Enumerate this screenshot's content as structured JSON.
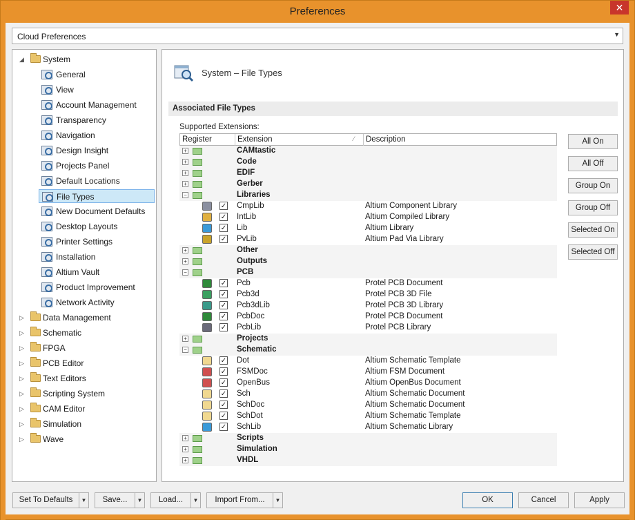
{
  "window": {
    "title": "Preferences",
    "close_glyph": "✕"
  },
  "cloud_combo": {
    "value": "Cloud Preferences"
  },
  "tree": {
    "items": [
      {
        "label": "System",
        "level": 0,
        "expanded": true,
        "icon": "folder-open-icon"
      },
      {
        "label": "General",
        "level": 1,
        "icon": "preferences-page-icon"
      },
      {
        "label": "View",
        "level": 1,
        "icon": "preferences-page-icon"
      },
      {
        "label": "Account Management",
        "level": 1,
        "icon": "preferences-page-icon"
      },
      {
        "label": "Transparency",
        "level": 1,
        "icon": "preferences-page-icon"
      },
      {
        "label": "Navigation",
        "level": 1,
        "icon": "preferences-page-icon"
      },
      {
        "label": "Design Insight",
        "level": 1,
        "icon": "preferences-page-icon"
      },
      {
        "label": "Projects Panel",
        "level": 1,
        "icon": "preferences-page-icon"
      },
      {
        "label": "Default Locations",
        "level": 1,
        "icon": "preferences-page-icon"
      },
      {
        "label": "File Types",
        "level": 1,
        "icon": "preferences-page-icon",
        "selected": true
      },
      {
        "label": "New Document Defaults",
        "level": 1,
        "icon": "preferences-page-icon"
      },
      {
        "label": "Desktop Layouts",
        "level": 1,
        "icon": "preferences-page-icon"
      },
      {
        "label": "Printer Settings",
        "level": 1,
        "icon": "preferences-page-icon"
      },
      {
        "label": "Installation",
        "level": 1,
        "icon": "preferences-page-icon"
      },
      {
        "label": "Altium Vault",
        "level": 1,
        "icon": "preferences-page-icon"
      },
      {
        "label": "Product Improvement",
        "level": 1,
        "icon": "preferences-page-icon"
      },
      {
        "label": "Network Activity",
        "level": 1,
        "icon": "preferences-page-icon"
      },
      {
        "label": "Data Management",
        "level": 0,
        "icon": "folder-icon"
      },
      {
        "label": "Schematic",
        "level": 0,
        "icon": "folder-icon"
      },
      {
        "label": "FPGA",
        "level": 0,
        "icon": "folder-icon"
      },
      {
        "label": "PCB Editor",
        "level": 0,
        "icon": "folder-icon"
      },
      {
        "label": "Text Editors",
        "level": 0,
        "icon": "folder-icon"
      },
      {
        "label": "Scripting System",
        "level": 0,
        "icon": "folder-icon"
      },
      {
        "label": "CAM Editor",
        "level": 0,
        "icon": "folder-icon"
      },
      {
        "label": "Simulation",
        "level": 0,
        "icon": "folder-icon"
      },
      {
        "label": "Wave",
        "level": 0,
        "icon": "folder-icon"
      }
    ]
  },
  "content": {
    "page_title": "System – File Types",
    "section_title": "Associated File Types",
    "supported_label": "Supported Extensions:",
    "columns": {
      "register": "Register",
      "extension": "Extension",
      "description": "Description",
      "sort_glyph": "⁄"
    },
    "rows": [
      {
        "type": "group",
        "name": "CAMtastic",
        "expanded": false
      },
      {
        "type": "group",
        "name": "Code",
        "expanded": false
      },
      {
        "type": "group",
        "name": "EDIF",
        "expanded": false
      },
      {
        "type": "group",
        "name": "Gerber",
        "expanded": false
      },
      {
        "type": "group",
        "name": "Libraries",
        "expanded": true
      },
      {
        "type": "file",
        "ext": "CmpLib",
        "desc": "Altium Component Library",
        "checked": true,
        "icon_color": "#8a8fa0"
      },
      {
        "type": "file",
        "ext": "IntLib",
        "desc": "Altium Compiled Library",
        "checked": true,
        "icon_color": "#e0b040"
      },
      {
        "type": "file",
        "ext": "Lib",
        "desc": "Altium Library",
        "checked": true,
        "icon_color": "#3a9ad9"
      },
      {
        "type": "file",
        "ext": "PvLib",
        "desc": "Altium Pad Via Library",
        "checked": true,
        "icon_color": "#c9a32a"
      },
      {
        "type": "group",
        "name": "Other",
        "expanded": false
      },
      {
        "type": "group",
        "name": "Outputs",
        "expanded": false
      },
      {
        "type": "group",
        "name": "PCB",
        "expanded": true
      },
      {
        "type": "file",
        "ext": "Pcb",
        "desc": "Protel PCB Document",
        "checked": true,
        "icon_color": "#2f8a3a"
      },
      {
        "type": "file",
        "ext": "Pcb3d",
        "desc": "Protel PCB 3D File",
        "checked": true,
        "icon_color": "#3aa060"
      },
      {
        "type": "file",
        "ext": "Pcb3dLib",
        "desc": "Protel PCB 3D Library",
        "checked": true,
        "icon_color": "#3a9a8a"
      },
      {
        "type": "file",
        "ext": "PcbDoc",
        "desc": "Protel PCB Document",
        "checked": true,
        "icon_color": "#2f8a3a"
      },
      {
        "type": "file",
        "ext": "PcbLib",
        "desc": "Protel PCB Library",
        "checked": true,
        "icon_color": "#6a6a7a"
      },
      {
        "type": "group",
        "name": "Projects",
        "expanded": false
      },
      {
        "type": "group",
        "name": "Schematic",
        "expanded": true
      },
      {
        "type": "file",
        "ext": "Dot",
        "desc": "Altium Schematic Template",
        "checked": true,
        "icon_color": "#f0d890"
      },
      {
        "type": "file",
        "ext": "FSMDoc",
        "desc": "Altium FSM Document",
        "checked": true,
        "icon_color": "#d05050"
      },
      {
        "type": "file",
        "ext": "OpenBus",
        "desc": "Altium OpenBus Document",
        "checked": true,
        "icon_color": "#d05050"
      },
      {
        "type": "file",
        "ext": "Sch",
        "desc": "Altium Schematic Document",
        "checked": true,
        "icon_color": "#f0d890"
      },
      {
        "type": "file",
        "ext": "SchDoc",
        "desc": "Altium Schematic Document",
        "checked": true,
        "icon_color": "#f0d890"
      },
      {
        "type": "file",
        "ext": "SchDot",
        "desc": "Altium Schematic Template",
        "checked": true,
        "icon_color": "#f0d890"
      },
      {
        "type": "file",
        "ext": "SchLib",
        "desc": "Altium Schematic Library",
        "checked": true,
        "icon_color": "#3a9ad9"
      },
      {
        "type": "group",
        "name": "Scripts",
        "expanded": false
      },
      {
        "type": "group",
        "name": "Simulation",
        "expanded": false
      },
      {
        "type": "group",
        "name": "VHDL",
        "expanded": false
      }
    ],
    "side_buttons": [
      "All On",
      "All Off",
      "Group On",
      "Group Off",
      "Selected On",
      "Selected Off"
    ]
  },
  "footer": {
    "set_to_defaults": "Set To Defaults",
    "save": "Save...",
    "load": "Load...",
    "import_from": "Import From...",
    "ok": "OK",
    "cancel": "Cancel",
    "apply": "Apply",
    "dropdown_glyph": "▼"
  },
  "colors": {
    "title_bar": "#e8922c",
    "close_button": "#c8352b",
    "selection": "#cde8f7",
    "accent_border": "#3c7fb1"
  }
}
